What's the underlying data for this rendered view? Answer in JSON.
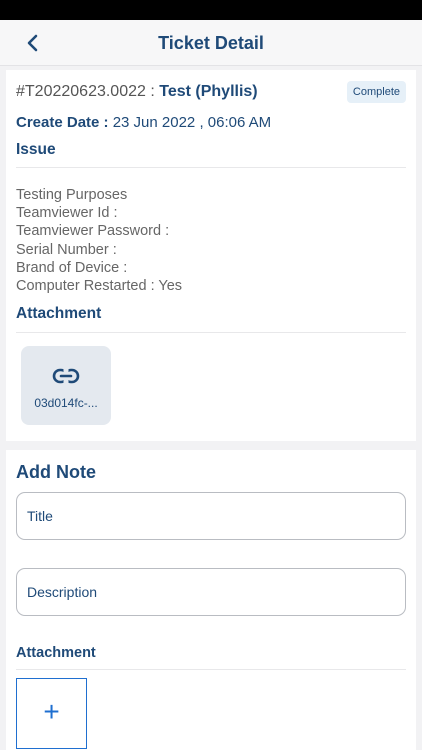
{
  "header": {
    "title": "Ticket Detail",
    "back_icon": "chevron-left-icon"
  },
  "ticket": {
    "number": "#T20220623.0022 : ",
    "name": "Test (Phyllis)",
    "status": "Complete",
    "create_label": "Create Date : ",
    "create_value": "23 Jun 2022 , 06:06 AM",
    "issue_heading": "Issue",
    "issue_lines": [
      "Testing Purposes",
      "Teamviewer Id :",
      "Teamviewer Password :",
      "Serial Number :",
      "Brand of Device :",
      "Computer Restarted : Yes"
    ],
    "attachment_heading": "Attachment",
    "attachment_file": "03d014fc-...",
    "attachment_icon": "link-icon"
  },
  "note": {
    "heading": "Add Note",
    "title_placeholder": "Title",
    "description_placeholder": "Description",
    "attachment_heading": "Attachment",
    "add_symbol": "+"
  },
  "colors": {
    "accent": "#1f4a78",
    "badge_bg": "#e6f0f8",
    "tile_bg": "#e4e9ef",
    "add_border": "#1f6fd0"
  }
}
